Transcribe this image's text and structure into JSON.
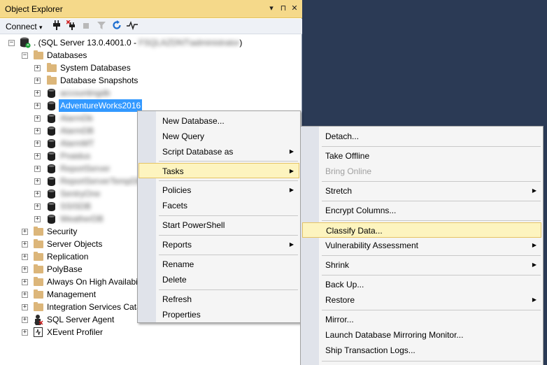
{
  "panel": {
    "title": "Object Explorer",
    "controls": {
      "dropdown": "▾",
      "pin": "⊓",
      "close": "✕"
    }
  },
  "toolbar": {
    "connect_label": "Connect",
    "connect_arrow": "▾"
  },
  "tree": {
    "server": ". (SQL Server 13.0.4001.0 - ",
    "server_user": "FSQLAZDNT\\administrator",
    "server_close": ")",
    "databases": "Databases",
    "system_databases": "System Databases",
    "database_snapshots": "Database Snapshots",
    "blurred_dbs": [
      "accountingdb",
      "AlarmDb",
      "AlarmDB",
      "AlarmMT",
      "Pnaidus",
      "ReportServer",
      "ReportServerTempDB",
      "SentryOne",
      "SSISDB",
      "WeatherDB"
    ],
    "selected_db": "AdventureWorks2016",
    "security": "Security",
    "server_objects": "Server Objects",
    "replication": "Replication",
    "polybase": "PolyBase",
    "always_on": "Always On High Availabi",
    "management": "Management",
    "integration_services": "Integration Services Cata",
    "agent": "SQL Server Agent",
    "xevent": "XEvent Profiler"
  },
  "menu1": {
    "new_database": "New Database...",
    "new_query": "New Query",
    "script_database": "Script Database as",
    "tasks": "Tasks",
    "policies": "Policies",
    "facets": "Facets",
    "start_powershell": "Start PowerShell",
    "reports": "Reports",
    "rename": "Rename",
    "delete": "Delete",
    "refresh": "Refresh",
    "properties": "Properties"
  },
  "menu2": {
    "detach": "Detach...",
    "take_offline": "Take Offline",
    "bring_online": "Bring Online",
    "stretch": "Stretch",
    "encrypt_columns": "Encrypt Columns...",
    "classify_data": "Classify Data...",
    "vulnerability": "Vulnerability Assessment",
    "shrink": "Shrink",
    "back_up": "Back Up...",
    "restore": "Restore",
    "mirror": "Mirror...",
    "launch_mirroring": "Launch Database Mirroring Monitor...",
    "ship_logs": "Ship Transaction Logs..."
  },
  "colors": {
    "title_bar": "#f5d98a",
    "selection": "#3399ff",
    "menu_highlight": "#fdf4bf",
    "background": "#2b3a55"
  }
}
